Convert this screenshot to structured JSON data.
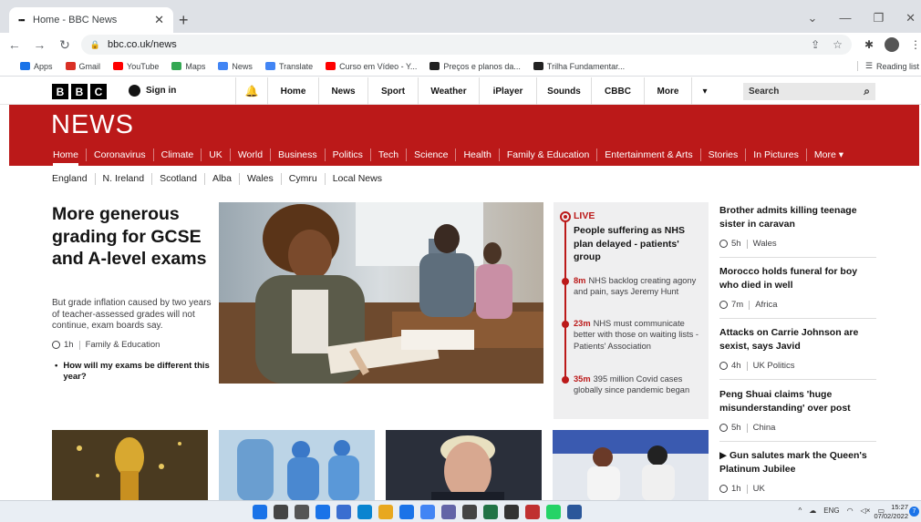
{
  "browser": {
    "tab_title": "Home - BBC News",
    "url": "bbc.co.uk/news",
    "bookmarks": [
      {
        "label": "Apps",
        "color": "#1a73e8"
      },
      {
        "label": "Gmail",
        "color": "#d93025"
      },
      {
        "label": "YouTube",
        "color": "#ff0000"
      },
      {
        "label": "Maps",
        "color": "#34a853"
      },
      {
        "label": "News",
        "color": "#4285f4"
      },
      {
        "label": "Translate",
        "color": "#4285f4"
      },
      {
        "label": "Curso em Vídeo - Y...",
        "color": "#ff0000"
      },
      {
        "label": "Preços e planos da...",
        "color": "#222222"
      },
      {
        "label": "Trilha Fundamentar...",
        "color": "#222222"
      }
    ],
    "reading_list": "Reading list"
  },
  "bbc_header": {
    "logo_letters": [
      "B",
      "B",
      "C"
    ],
    "sign_in": "Sign in",
    "nav": [
      {
        "label": "Home",
        "w": 56
      },
      {
        "label": "News",
        "w": 54
      },
      {
        "label": "Sport",
        "w": 55
      },
      {
        "label": "Weather",
        "w": 67
      },
      {
        "label": "iPlayer",
        "w": 63
      },
      {
        "label": "Sounds",
        "w": 60
      },
      {
        "label": "CBBC",
        "w": 58
      },
      {
        "label": "More",
        "w": 52
      }
    ],
    "more_arrow": "▾",
    "search_placeholder": "Search"
  },
  "news": {
    "logo": "NEWS",
    "sections": [
      "Home",
      "Coronavirus",
      "Climate",
      "UK",
      "World",
      "Business",
      "Politics",
      "Tech",
      "Science",
      "Health",
      "Family & Education",
      "Entertainment & Arts",
      "Stories",
      "In Pictures",
      "More ▾"
    ],
    "regions": [
      "England",
      "N. Ireland",
      "Scotland",
      "Alba",
      "Wales",
      "Cymru",
      "Local News"
    ]
  },
  "lead": {
    "headline": "More generous grading for GCSE and A-level exams",
    "summary": "But grade inflation caused by two years of teacher-assessed grades will not continue, exam boards say.",
    "time": "1h",
    "tag": "Family & Education",
    "related": "How will my exams be different this year?"
  },
  "live": {
    "label": "LIVE",
    "headline": "People suffering as NHS plan delayed - patients' group",
    "updates": [
      {
        "time": "8m",
        "text": "NHS backlog creating agony and pain, says Jeremy Hunt"
      },
      {
        "time": "23m",
        "text": "NHS must communicate better with those on waiting lists - Patients' Association"
      },
      {
        "time": "35m",
        "text": "395 million Covid cases globally since pandemic began"
      }
    ]
  },
  "right_stories": [
    {
      "headline": "Brother admits killing teenage sister in caravan",
      "time": "5h",
      "tag": "Wales"
    },
    {
      "headline": "Morocco holds funeral for boy who died in well",
      "time": "7m",
      "tag": "Africa"
    },
    {
      "headline": "Attacks on Carrie Johnson are sexist, says Javid",
      "time": "4h",
      "tag": "UK Politics"
    },
    {
      "headline": "Peng Shuai claims 'huge misunderstanding' over post",
      "time": "5h",
      "tag": "China"
    },
    {
      "headline": "▶ Gun salutes mark the Queen's Platinum Jubilee",
      "time": "1h",
      "tag": "UK"
    }
  ],
  "taskbar": {
    "lang": "ENG",
    "time": "15:27",
    "date": "07/02/2022",
    "notifications": "7"
  }
}
